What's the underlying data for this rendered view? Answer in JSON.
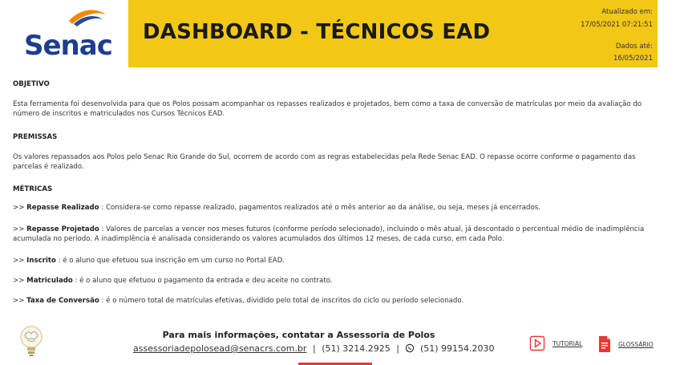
{
  "header": {
    "title": "DASHBOARD - TÉCNICOS EAD",
    "updated_label": "Atualizado em:",
    "updated_value": "17/05/2021 07:21:51",
    "data_label": "Dados até:",
    "data_value": "16/05/2021",
    "banner_color": "#f2c716"
  },
  "logo": {
    "text": "Senac",
    "brand_color": "#1e3d8f",
    "accent_color": "#f18a00"
  },
  "sections": {
    "objetivo": {
      "title": "OBJETIVO",
      "text": "Esta ferramenta foi desenvolvida para que os Polos possam acompanhar os repasses realizados e projetados, bem como a taxa de conversão de matrículas por meio da avaliação do número de inscritos e matriculados nos Cursos Técnicos EAD."
    },
    "premissas": {
      "title": "PREMISSAS",
      "text": "Os valores repassados aos Polos pelo Senac Rio Grande do Sul, ocorrem de acordo com as regras estabelecidas pela Rede Senac EAD. O repasse ocorre conforme o pagamento das parcelas é realizado."
    },
    "metricas": {
      "title": "MÉTRICAS",
      "items": [
        {
          "prefix": ">> ",
          "term": "Repasse Realizado",
          "text": " : Considera-se como repasse realizado, pagamentos realizados até o mês anterior ao da análise, ou seja, meses já encerrados."
        },
        {
          "prefix": ">> ",
          "term": "Repasse Projetado",
          "text": " : Valores de parcelas a vencer nos meses futuros (conforme período selecionado), incluindo o mês atual, já descontado o percentual médio de inadimplência acumulada no período. A inadimplência é analisada considerando os valores acumulados dos últimos 12 meses, de cada curso, em cada Polo."
        },
        {
          "prefix": ">> ",
          "term": "Inscrito",
          "text": " : é o aluno que efetuou sua inscrição em um curso no Portal EAD."
        },
        {
          "prefix": ">> ",
          "term": "Matriculado",
          "text": " : é o aluno que efetuou o pagamento da entrada e deu aceite no contrato."
        },
        {
          "prefix": ">> ",
          "term": "Taxa de Conversão",
          "text": " : é o número total de matrículas efetivas, dividido pelo total de inscritos do ciclo ou período selecionado."
        }
      ]
    }
  },
  "footer": {
    "heading": "Para mais informações, contatar a Assessoria de Polos",
    "email": "assessoriadepolosead@senacrs.com.br",
    "separator": "|",
    "phone": "(51) 3214.2925",
    "whatsapp": "(51) 99154.2030",
    "whatsapp_icon": "whatsapp-icon",
    "tutorial_label": "TUTORIAL",
    "tutorial_icon": "play-icon",
    "glossario_label": "GLOSSÁRIO",
    "glossario_icon": "document-icon",
    "icon_color": "#e53935"
  }
}
